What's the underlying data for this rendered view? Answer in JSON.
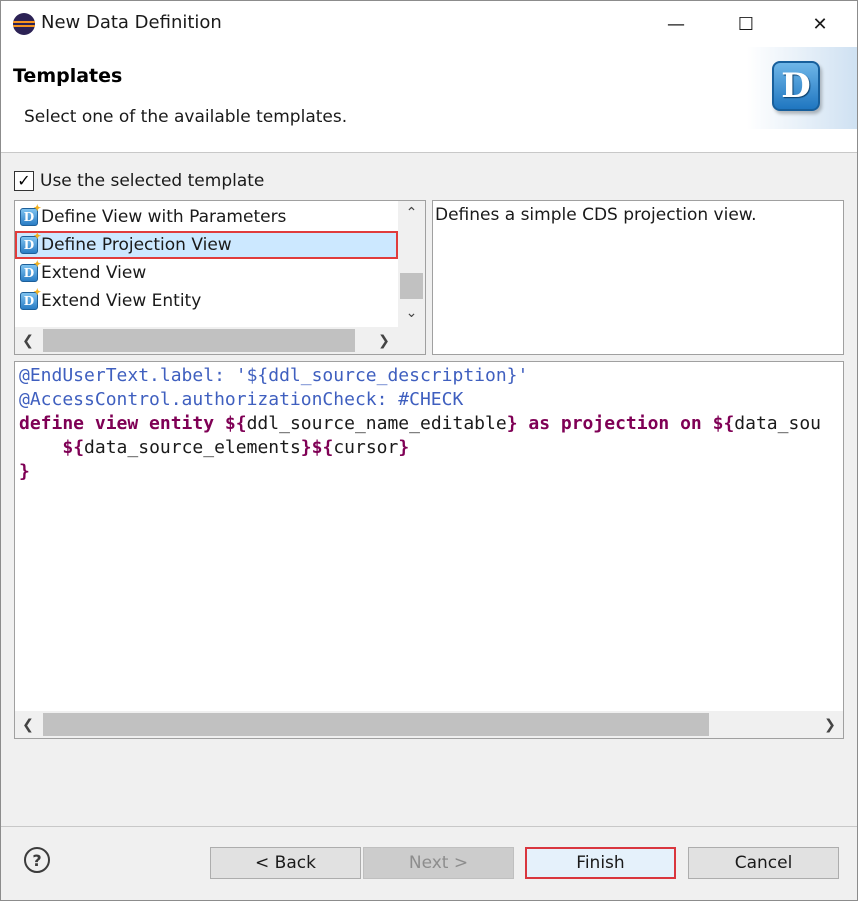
{
  "window": {
    "title": "New Data Definition",
    "minimize_glyph": "—",
    "maximize_glyph": "☐",
    "close_glyph": "✕"
  },
  "banner": {
    "title": "Templates",
    "message": "Select one of the available templates.",
    "image_letter": "D"
  },
  "use_template": {
    "checked": true,
    "check_glyph": "✓",
    "label": "Use the selected template"
  },
  "template_list": {
    "items": [
      {
        "label": "Define View with Parameters",
        "icon": "cds-template-icon",
        "selected": false
      },
      {
        "label": "Define Projection View",
        "icon": "cds-template-icon",
        "selected": true
      },
      {
        "label": "Extend View",
        "icon": "cds-template-icon",
        "selected": false
      },
      {
        "label": "Extend View Entity",
        "icon": "cds-template-icon",
        "selected": false
      }
    ],
    "icon_letter": "D",
    "icon_badge": "✦"
  },
  "description": "Defines a simple CDS projection view.",
  "code": {
    "line1": "@EndUserText.label: '${ddl_source_description}'",
    "line2": "@AccessControl.authorizationCheck: #CHECK",
    "line3_kw1": "define view entity ",
    "line3_t1": "${",
    "line3_t2": "ddl_source_name_editable",
    "line3_t3": "}",
    "line3_kw2": " as projection on ",
    "line3_t4": "${",
    "line3_t5": "data_sou",
    "line4_indent": "    ",
    "line4_t1": "${",
    "line4_t2": "data_source_elements",
    "line4_t3": "}${",
    "line4_t4": "cursor",
    "line4_t5": "}",
    "line5": "}"
  },
  "scroll_glyphs": {
    "up": "⌃",
    "down": "⌄",
    "left": "❮",
    "right": "❯"
  },
  "footer": {
    "help_glyph": "?",
    "back_label": "< Back",
    "next_label": "Next >",
    "finish_label": "Finish",
    "cancel_label": "Cancel"
  },
  "colors": {
    "selection": "#cce8ff",
    "highlight_border": "#e03c3c",
    "annotation": "#3f5fbf",
    "keyword": "#7f0055"
  }
}
